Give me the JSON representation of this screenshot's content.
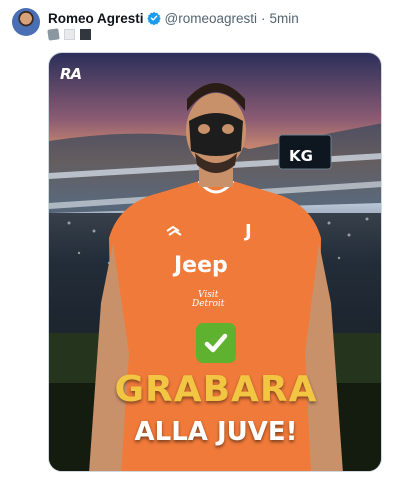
{
  "tweet": {
    "author_name": "Romeo Agresti",
    "handle": "@romeoagresti",
    "separator": "·",
    "timestamp": "5min",
    "verified": true,
    "emojis": [
      "rock-emoji",
      "white-square-emoji",
      "black-square-emoji"
    ]
  },
  "media": {
    "logo_text": "RA",
    "scoreboard_text": "KG",
    "jersey_sponsor": "Jeep",
    "sleeve_line1": "Visit",
    "sleeve_line2": "Detroit",
    "check_emoji": "✔",
    "headline_line1": "GRABARA",
    "headline_line2": "ALLA JUVE!"
  },
  "colors": {
    "verified": "#1d9bf0",
    "jersey": "#f07a3a",
    "headline_yellow": "#f2c542",
    "check_green": "#5fb130"
  }
}
